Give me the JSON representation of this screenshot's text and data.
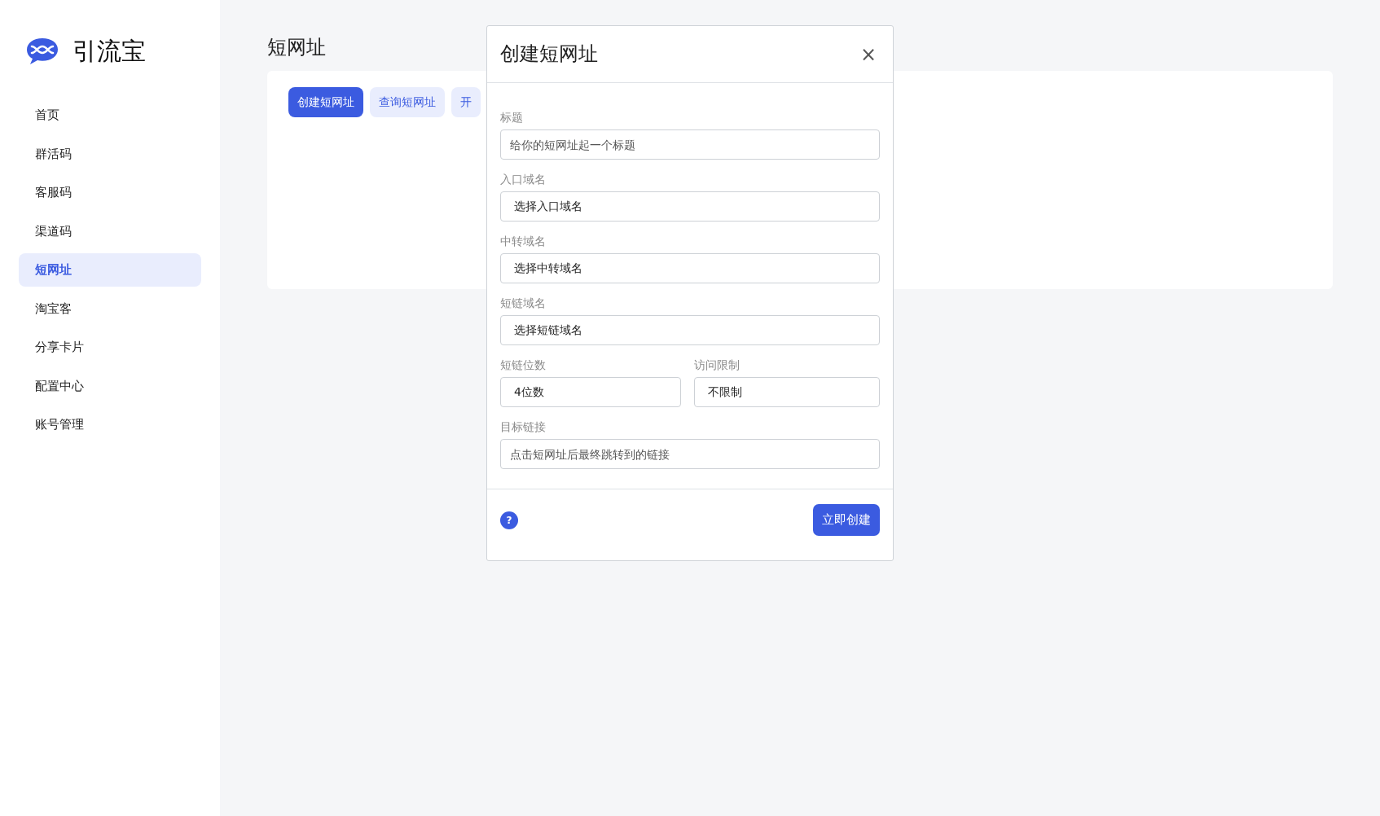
{
  "sidebar": {
    "brand": "引流宝",
    "items": [
      {
        "label": "首页",
        "selected": false
      },
      {
        "label": "群活码",
        "selected": false
      },
      {
        "label": "客服码",
        "selected": false
      },
      {
        "label": "渠道码",
        "selected": false
      },
      {
        "label": "短网址",
        "selected": true
      },
      {
        "label": "淘宝客",
        "selected": false
      },
      {
        "label": "分享卡片",
        "selected": false
      },
      {
        "label": "配置中心",
        "selected": false
      },
      {
        "label": "账号管理",
        "selected": false
      }
    ]
  },
  "page": {
    "title": "短网址",
    "buttons": [
      {
        "label": "创建短网址",
        "selected": true
      },
      {
        "label": "查询短网址",
        "selected": false
      },
      {
        "label": "开",
        "selected": false
      }
    ]
  },
  "modal": {
    "title": "创建短网址",
    "close": "×",
    "rows": [
      [
        {
          "kind": "input",
          "label": "标题",
          "placeholder": "给你的短网址起一个标题"
        }
      ],
      [
        {
          "kind": "select",
          "label": "入口域名",
          "value": "选择入口域名"
        }
      ],
      [
        {
          "kind": "select",
          "label": "中转域名",
          "value": "选择中转域名"
        }
      ],
      [
        {
          "kind": "select",
          "label": "短链域名",
          "value": "选择短链域名"
        }
      ],
      [
        {
          "kind": "select",
          "label": "短链位数",
          "value": "4位数"
        },
        {
          "kind": "select",
          "label": "访问限制",
          "value": "不限制"
        }
      ],
      [
        {
          "kind": "input",
          "label": "目标链接",
          "placeholder": "点击短网址后最终跳转到的链接"
        }
      ]
    ],
    "help": "?",
    "submit": "立即创建"
  }
}
